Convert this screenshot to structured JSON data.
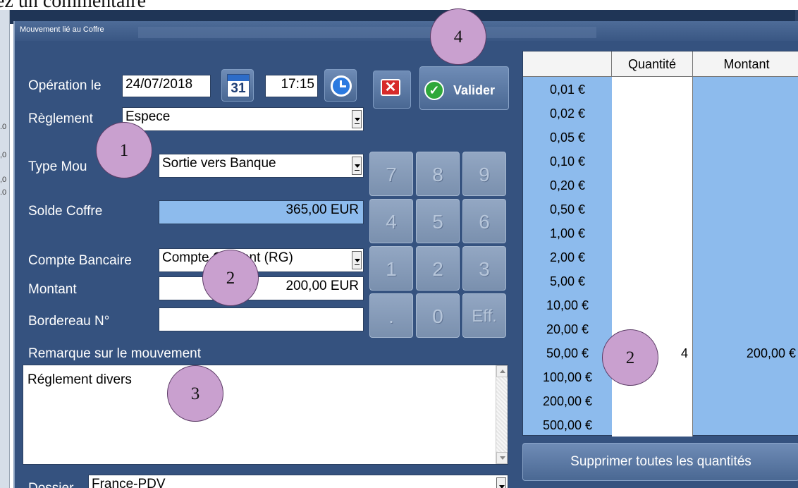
{
  "background": {
    "doc_text": "ez un commentaire",
    "left_ticks": [
      ".0",
      ",0",
      ",0",
      ".0"
    ]
  },
  "window": {
    "title": "Mouvement lié au Coffre"
  },
  "form": {
    "operation_label": "Opération le",
    "date_value": "24/07/2018",
    "calendar_day": "31",
    "time_value": "17:15",
    "reglement_label": "Règlement",
    "reglement_value": "Espece",
    "type_label": "Type Mou",
    "type_value": "Sortie vers Banque",
    "solde_label": "Solde Coffre",
    "solde_value": "365,00 EUR",
    "compte_label": "Compte Bancaire",
    "compte_value": "Compte Courant (RG)",
    "montant_label": "Montant",
    "montant_value": "200,00 EUR",
    "bordereau_label": "Bordereau N°",
    "bordereau_value": "",
    "remarque_label": "Remarque sur le mouvement",
    "remarque_value": "Réglement divers",
    "dossier_label": "Dossier",
    "dossier_value": "France-PDV"
  },
  "buttons": {
    "valider": "Valider",
    "supprimer": "Supprimer toutes les quantités"
  },
  "keypad": [
    "7",
    "8",
    "9",
    "4",
    "5",
    "6",
    "1",
    "2",
    "3",
    ".",
    "0",
    "Eff."
  ],
  "grid": {
    "header_qty": "Quantité",
    "header_montant": "Montant",
    "denominations": [
      "0,01 €",
      "0,02 €",
      "0,05 €",
      "0,10 €",
      "0,20 €",
      "0,50 €",
      "1,00 €",
      "2,00 €",
      "5,00 €",
      "10,00 €",
      "20,00 €",
      "50,00 €",
      "100,00 €",
      "200,00 €",
      "500,00 €"
    ],
    "rows": [
      {
        "quantity": "",
        "montant": ""
      },
      {
        "quantity": "",
        "montant": ""
      },
      {
        "quantity": "",
        "montant": ""
      },
      {
        "quantity": "",
        "montant": ""
      },
      {
        "quantity": "",
        "montant": ""
      },
      {
        "quantity": "",
        "montant": ""
      },
      {
        "quantity": "",
        "montant": ""
      },
      {
        "quantity": "",
        "montant": ""
      },
      {
        "quantity": "",
        "montant": ""
      },
      {
        "quantity": "",
        "montant": ""
      },
      {
        "quantity": "",
        "montant": ""
      },
      {
        "quantity": "4",
        "montant": "200,00 €"
      },
      {
        "quantity": "",
        "montant": ""
      },
      {
        "quantity": "",
        "montant": ""
      },
      {
        "quantity": "",
        "montant": ""
      }
    ]
  },
  "annotations": {
    "a1": "1",
    "a2": "2",
    "a3": "3",
    "a4": "4",
    "a5": "2"
  },
  "colors": {
    "window_bg": "#35527f",
    "highlight_field": "#8dbbed",
    "badge": "#c9a0cf"
  },
  "icons": [
    "calendar-icon",
    "clock-icon",
    "cancel-icon",
    "check-icon",
    "dropdown-arrow-icon"
  ]
}
